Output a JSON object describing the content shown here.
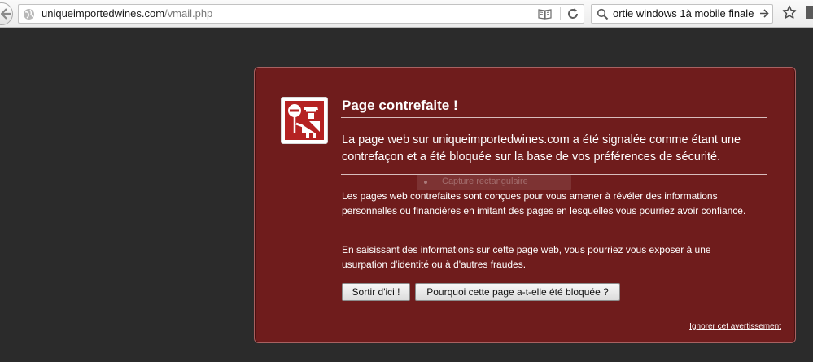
{
  "browser": {
    "url_domain": "uniqueimportedwines.com",
    "url_path": "/vmail.php",
    "search_query": "ortie windows 1à mobile finale"
  },
  "warning": {
    "title": "Page contrefaite !",
    "lead": "La page web sur uniqueimportedwines.com a été signalée comme étant une contrefaçon et a été bloquée sur la base de vos préférences de sécurité.",
    "paragraph_1": "Les pages web contrefaites sont conçues pour vous amener à révéler des informations personnelles ou financières en imitant des pages en lesquelles vous pourriez avoir confiance.",
    "paragraph_2": "En saisissant des informations sur cette page web, vous pourriez vous exposer à une usurpation d'identité ou à d'autres fraudes.",
    "leave_button": "Sortir d'ici !",
    "why_button": "Pourquoi cette page a-t-elle été bloquée ?",
    "ignore_link": "Ignorer cet avertissement",
    "ghost_text": "Capture rectangulaire"
  },
  "colors": {
    "page_background": "#2b2b2b",
    "panel_background": "#6f1c1c",
    "panel_border": "#a86161",
    "icon_red": "#b52222"
  }
}
